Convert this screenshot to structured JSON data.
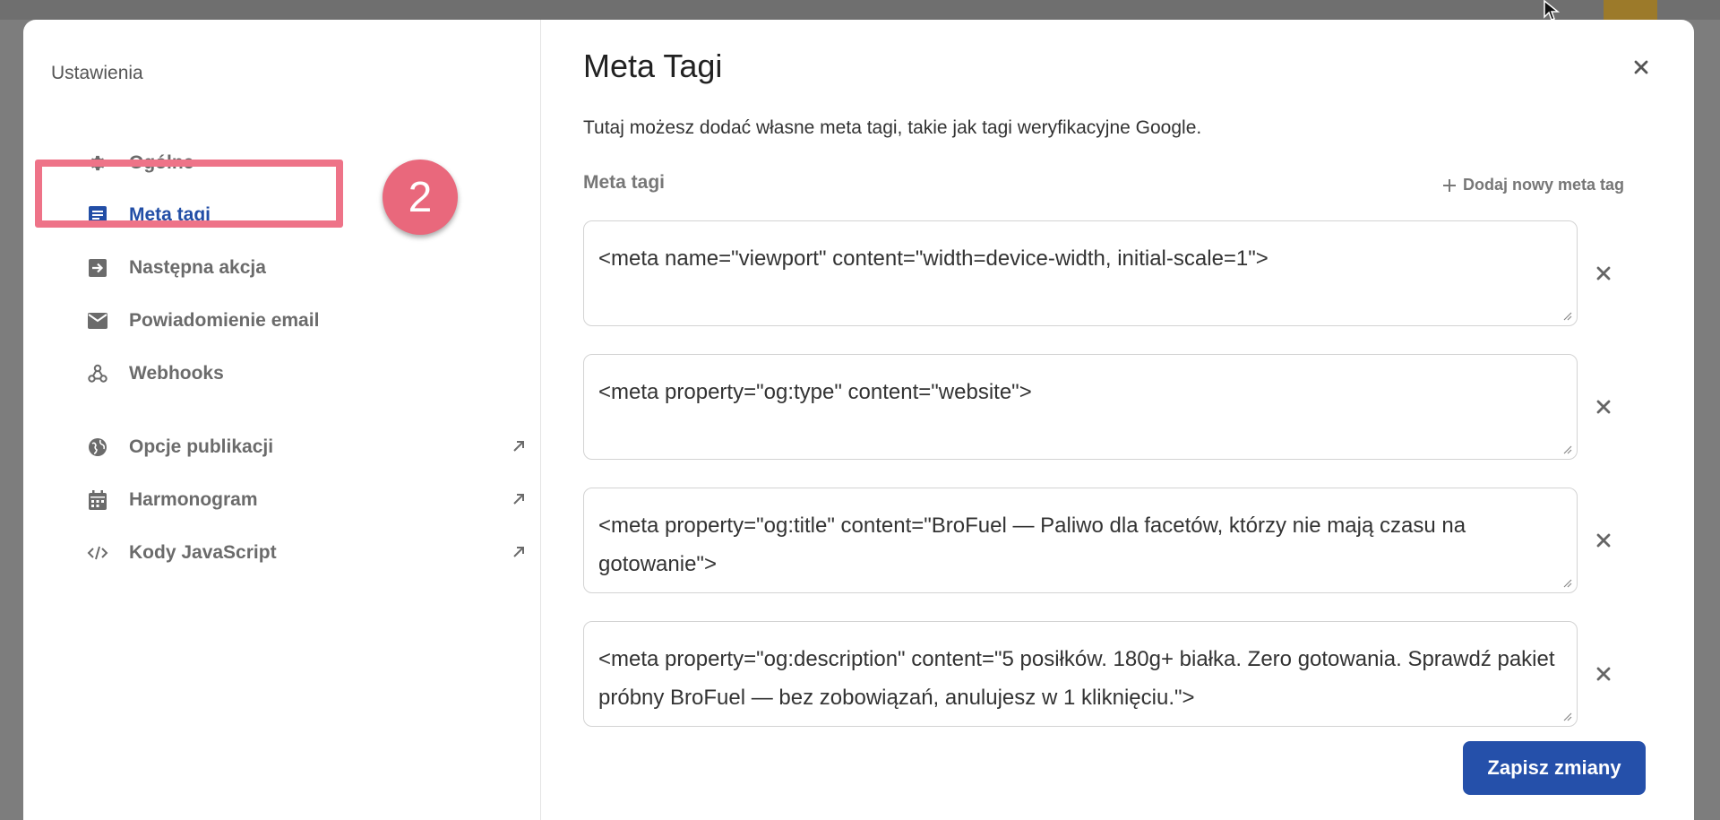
{
  "sidebar": {
    "title": "Ustawienia",
    "items": [
      {
        "label": "Ogólne",
        "icon": "gear-icon"
      },
      {
        "label": "Meta tagi",
        "icon": "document-icon",
        "active": true
      },
      {
        "label": "Następna akcja",
        "icon": "arrow-right-box-icon"
      },
      {
        "label": "Powiadomienie email",
        "icon": "mail-icon"
      },
      {
        "label": "Webhooks",
        "icon": "webhook-icon"
      },
      {
        "label": "Opcje publikacji",
        "icon": "globe-icon",
        "external": true
      },
      {
        "label": "Harmonogram",
        "icon": "calendar-icon",
        "external": true
      },
      {
        "label": "Kody JavaScript",
        "icon": "code-icon",
        "external": true
      }
    ]
  },
  "annotation": {
    "step_number": "2"
  },
  "main": {
    "title": "Meta Tagi",
    "description": "Tutaj możesz dodać własne meta tagi, takie jak tagi weryfikacyjne Google.",
    "section_label": "Meta tagi",
    "add_label": "Dodaj nowy meta tag",
    "meta_tags": [
      "<meta name=\"viewport\" content=\"width=device-width, initial-scale=1\">",
      "<meta property=\"og:type\" content=\"website\">",
      "<meta property=\"og:title\" content=\"BroFuel — Paliwo dla facetów, którzy nie mają czasu na gotowanie\">",
      "<meta property=\"og:description\" content=\"5 posiłków. 180g+ białka. Zero gotowania. Sprawdź pakiet próbny BroFuel — bez zobowiązań, anulujesz w 1 kliknięciu.\">"
    ],
    "save_label": "Zapisz zmiany"
  },
  "colors": {
    "accent": "#224ea6",
    "annotation": "#ee7388",
    "button": "#2550aa"
  }
}
